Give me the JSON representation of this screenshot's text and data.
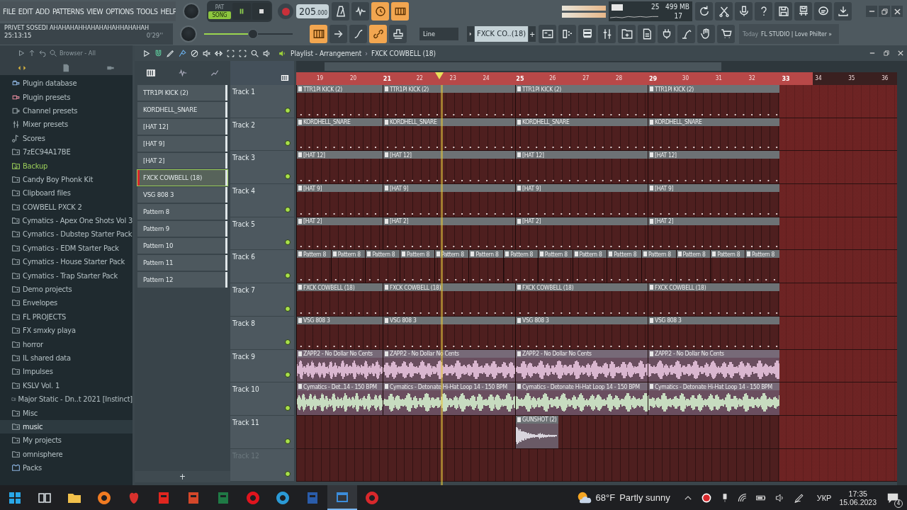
{
  "menu": [
    "FILE",
    "EDIT",
    "ADD",
    "PATTERNS",
    "VIEW",
    "OPTIONS",
    "TOOLS",
    "HELP"
  ],
  "modes": [
    {
      "label": "PAT",
      "selected": false
    },
    {
      "label": "SONG",
      "selected": true
    }
  ],
  "transport": {
    "playing": true,
    "recording": false
  },
  "tempo": {
    "whole": "205",
    "fraction": ".000"
  },
  "toolbar_top": [
    {
      "kind": "metronome",
      "on": false
    },
    {
      "kind": "wave",
      "on": false
    },
    {
      "kind": "clock",
      "on": true
    },
    {
      "kind": "keys",
      "on": true
    }
  ],
  "cpu": {
    "cpu": "25",
    "memory": "499 MB",
    "polyphony": "17"
  },
  "toolbar_right": [
    {
      "kind": "undo"
    },
    {
      "kind": "scissors"
    },
    {
      "kind": "mic"
    },
    {
      "kind": "help"
    },
    {
      "kind": "save"
    },
    {
      "kind": "save-bars"
    },
    {
      "kind": "chat"
    },
    {
      "kind": "download"
    }
  ],
  "hint": {
    "text": "PRIVET SOSEDI AHAHAHAHHAHAHAHAHHAHAHAH",
    "time": "25:13:15",
    "duration": "0'29''"
  },
  "master": {
    "level": 0.55
  },
  "toolbar_bottom": [
    {
      "kind": "piano",
      "on": true
    },
    {
      "kind": "arrow",
      "on": false
    },
    {
      "kind": "curve",
      "on": false
    },
    {
      "kind": "link",
      "on": true
    },
    {
      "kind": "stamp",
      "on": false
    }
  ],
  "snap": {
    "value": "Line"
  },
  "pattern_selector": {
    "value": "FXCK CO..(18)",
    "add": "+"
  },
  "windows_bar": [
    {
      "kind": "playlist"
    },
    {
      "kind": "steps"
    },
    {
      "kind": "channels"
    },
    {
      "kind": "mixer"
    },
    {
      "kind": "browser"
    },
    {
      "kind": "files"
    },
    {
      "kind": "plug"
    },
    {
      "kind": "arm"
    },
    {
      "kind": "hand"
    },
    {
      "kind": "cart"
    }
  ],
  "news": {
    "label": "Today",
    "text": "FL STUDIO | Love Philter »"
  },
  "browser": {
    "title": "Browser - All",
    "items": [
      {
        "label": "Plugin database",
        "kind": "plugin",
        "selected": false
      },
      {
        "label": "Plugin presets",
        "kind": "preset",
        "selected": false
      },
      {
        "label": "Channel presets",
        "kind": "channel",
        "selected": false
      },
      {
        "label": "Mixer presets",
        "kind": "mixer",
        "selected": false
      },
      {
        "label": "Scores",
        "kind": "note",
        "selected": false
      },
      {
        "label": "7zEC94A17BE",
        "kind": "folder",
        "selected": false
      },
      {
        "label": "Backup",
        "kind": "backup",
        "selected": false
      },
      {
        "label": "Candy Boy Phonk Kit",
        "kind": "folder",
        "selected": false
      },
      {
        "label": "Clipboard files",
        "kind": "folder",
        "selected": false
      },
      {
        "label": "COWBELL PXCK 2",
        "kind": "folder",
        "selected": false
      },
      {
        "label": "Cymatics - Apex One Shots Vol 3",
        "kind": "folder",
        "selected": false
      },
      {
        "label": "Cymatics - Dubstep Starter Pack",
        "kind": "folder",
        "selected": false
      },
      {
        "label": "Cymatics - EDM Starter Pack",
        "kind": "folder",
        "selected": false
      },
      {
        "label": "Cymatics - House Starter Pack",
        "kind": "folder",
        "selected": false
      },
      {
        "label": "Cymatics - Trap Starter Pack",
        "kind": "folder",
        "selected": false
      },
      {
        "label": "Demo projects",
        "kind": "folder",
        "selected": false
      },
      {
        "label": "Envelopes",
        "kind": "folder",
        "selected": false
      },
      {
        "label": "FL PROJECTS",
        "kind": "folder",
        "selected": false
      },
      {
        "label": "FX smxky playa",
        "kind": "folder",
        "selected": false
      },
      {
        "label": "horror",
        "kind": "folder",
        "selected": false
      },
      {
        "label": "IL shared data",
        "kind": "folder",
        "selected": false
      },
      {
        "label": "Impulses",
        "kind": "folder",
        "selected": false
      },
      {
        "label": "KSLV Vol. 1",
        "kind": "folder",
        "selected": false
      },
      {
        "label": "Major Static - Dn..t 2021 [Instinct]",
        "kind": "folder",
        "selected": false
      },
      {
        "label": "Misc",
        "kind": "folder",
        "selected": false
      },
      {
        "label": "music",
        "kind": "folder",
        "selected": true
      },
      {
        "label": "My projects",
        "kind": "folder",
        "selected": false
      },
      {
        "label": "omnisphere",
        "kind": "folder",
        "selected": false
      },
      {
        "label": "Packs",
        "kind": "packs",
        "selected": false
      }
    ]
  },
  "playlist": {
    "title": "Playlist - Arrangement",
    "separator": "›",
    "pattern": "FXCK COWBELL (18)"
  },
  "patterns": [
    {
      "label": "TTR1PI KICK (2)",
      "selected": false
    },
    {
      "label": "KORDHELL_SNARE",
      "selected": false
    },
    {
      "label": "[HAT 12]",
      "selected": false
    },
    {
      "label": "[HAT 9]",
      "selected": false
    },
    {
      "label": "[HAT 2]",
      "selected": false
    },
    {
      "label": "FXCK COWBELL  (18)",
      "selected": true
    },
    {
      "label": "VSG 808 3",
      "selected": false
    },
    {
      "label": "Pattern 8",
      "selected": false
    },
    {
      "label": "Pattern 9",
      "selected": false
    },
    {
      "label": "Pattern 10",
      "selected": false
    },
    {
      "label": "Pattern 11",
      "selected": false
    },
    {
      "label": "Pattern 12",
      "selected": false
    }
  ],
  "add_pattern": "+",
  "ruler": [
    {
      "label": "19",
      "major": false
    },
    {
      "label": "20",
      "major": false
    },
    {
      "label": "21",
      "major": true
    },
    {
      "label": "22",
      "major": false
    },
    {
      "label": "23",
      "major": false
    },
    {
      "label": "24",
      "major": false
    },
    {
      "label": "25",
      "major": true
    },
    {
      "label": "26",
      "major": false
    },
    {
      "label": "27",
      "major": false
    },
    {
      "label": "28",
      "major": false
    },
    {
      "label": "29",
      "major": true
    },
    {
      "label": "30",
      "major": false
    },
    {
      "label": "31",
      "major": false
    },
    {
      "label": "32",
      "major": false
    },
    {
      "label": "33",
      "major": true
    },
    {
      "label": "34",
      "major": false
    },
    {
      "label": "35",
      "major": false
    },
    {
      "label": "36",
      "major": false
    }
  ],
  "tracks": [
    {
      "name": "Track 1",
      "greyed": false,
      "clips": [
        {
          "kind": "pattern",
          "label": "TTR1PI KICK (2)"
        },
        {
          "kind": "pattern",
          "label": "TTR1PI KICK (2)"
        },
        {
          "kind": "pattern",
          "label": "TTR1PI KICK (2)"
        },
        {
          "kind": "pattern",
          "label": "TTR1PI KICK (2)"
        }
      ]
    },
    {
      "name": "Track 2",
      "greyed": false,
      "clips": [
        {
          "kind": "pattern",
          "label": "KORDHELL_SNARE"
        },
        {
          "kind": "pattern",
          "label": "KORDHELL_SNARE"
        },
        {
          "kind": "pattern",
          "label": "KORDHELL_SNARE"
        },
        {
          "kind": "pattern",
          "label": "KORDHELL_SNARE"
        }
      ]
    },
    {
      "name": "Track 3",
      "greyed": false,
      "clips": [
        {
          "kind": "pattern",
          "label": "[HAT 12]"
        },
        {
          "kind": "pattern",
          "label": "[HAT 12]"
        },
        {
          "kind": "pattern",
          "label": "[HAT 12]"
        },
        {
          "kind": "pattern",
          "label": "[HAT 12]"
        }
      ]
    },
    {
      "name": "Track 4",
      "greyed": false,
      "clips": [
        {
          "kind": "pattern",
          "label": "[HAT 9]"
        },
        {
          "kind": "pattern",
          "label": "[HAT 9]"
        },
        {
          "kind": "pattern",
          "label": "[HAT 9]"
        },
        {
          "kind": "pattern",
          "label": "[HAT 9]"
        }
      ]
    },
    {
      "name": "Track 5",
      "greyed": false,
      "clips": [
        {
          "kind": "pattern",
          "label": "[HAT 2]"
        },
        {
          "kind": "pattern",
          "label": "[HAT 2]"
        },
        {
          "kind": "pattern",
          "label": "[HAT 2]"
        },
        {
          "kind": "pattern",
          "label": "[HAT 2]"
        }
      ]
    },
    {
      "name": "Track 6",
      "greyed": false,
      "clips": [
        {
          "kind": "pattern",
          "label": "Pattern 8"
        },
        {
          "kind": "pattern",
          "label": "Pattern 8"
        },
        {
          "kind": "pattern",
          "label": "Pattern 8"
        },
        {
          "kind": "pattern",
          "label": "Pattern 8"
        },
        {
          "kind": "pattern",
          "label": "Pattern 8"
        },
        {
          "kind": "pattern",
          "label": "Pattern 8"
        },
        {
          "kind": "pattern",
          "label": "Pattern 8"
        },
        {
          "kind": "pattern",
          "label": "Pattern 8"
        },
        {
          "kind": "pattern",
          "label": "Pattern 8"
        },
        {
          "kind": "pattern",
          "label": "Pattern 8"
        },
        {
          "kind": "pattern",
          "label": "Pattern 8"
        },
        {
          "kind": "pattern",
          "label": "Pattern 8"
        },
        {
          "kind": "pattern",
          "label": "Pattern 8"
        },
        {
          "kind": "pattern",
          "label": "Pattern 8"
        }
      ]
    },
    {
      "name": "Track 7",
      "greyed": false,
      "clips": [
        {
          "kind": "pattern",
          "label": "FXCK COWBELL  (18)"
        },
        {
          "kind": "pattern",
          "label": "FXCK COWBELL  (18)"
        },
        {
          "kind": "pattern",
          "label": "FXCK COWBELL  (18)"
        },
        {
          "kind": "pattern",
          "label": "FXCK COWBELL  (18)"
        }
      ]
    },
    {
      "name": "Track 8",
      "greyed": false,
      "clips": [
        {
          "kind": "pattern",
          "label": "VSG 808 3"
        },
        {
          "kind": "pattern",
          "label": "VSG 808 3"
        },
        {
          "kind": "pattern",
          "label": "VSG 808 3"
        },
        {
          "kind": "pattern",
          "label": "VSG 808 3"
        }
      ]
    },
    {
      "name": "Track 9",
      "greyed": false,
      "color": "#d9b6cf",
      "clips": [
        {
          "kind": "audio",
          "label": "ZAPP.2 - No Dollar No Cents"
        },
        {
          "kind": "audio",
          "label": "ZAPP.2 - No Dollar No Cents"
        },
        {
          "kind": "audio",
          "label": "ZAPP.2 - No Dollar No Cents"
        },
        {
          "kind": "audio",
          "label": "ZAPP.2 - No Dollar No Cents"
        }
      ]
    },
    {
      "name": "Track 10",
      "greyed": false,
      "color": "#c7dcc0",
      "clips": [
        {
          "kind": "audio",
          "label": "Cymatics - Det..14 - 150 BPM"
        },
        {
          "kind": "audio",
          "label": "Cymatics - Detonate Hi-Hat Loop 14 - 150 BPM"
        },
        {
          "kind": "audio",
          "label": "Cymatics - Detonate Hi-Hat Loop 14 - 150 BPM"
        },
        {
          "kind": "audio",
          "label": "Cymatics - Detonate Hi-Hat Loop 14 - 150 BPM"
        }
      ]
    },
    {
      "name": "Track 11",
      "greyed": false,
      "color": "#d8d4dc",
      "clips": [
        {
          "kind": "oneshot",
          "label": "GUNSHOT (2)"
        }
      ]
    },
    {
      "name": "Track 12",
      "greyed": true
    }
  ],
  "taskbar": {
    "apps": [
      {
        "kind": "start",
        "selected": false
      },
      {
        "kind": "task-view",
        "selected": false
      },
      {
        "kind": "folder",
        "selected": false
      },
      {
        "kind": "globe",
        "selected": false
      },
      {
        "kind": "fruit",
        "selected": false
      },
      {
        "kind": "pdf",
        "selected": false
      },
      {
        "kind": "slides",
        "selected": false
      },
      {
        "kind": "sheet",
        "selected": false
      },
      {
        "kind": "ring",
        "selected": false
      },
      {
        "kind": "swirl",
        "selected": false
      },
      {
        "kind": "doc",
        "selected": false
      },
      {
        "kind": "window",
        "selected": true
      },
      {
        "kind": "record",
        "selected": false
      }
    ],
    "weather": {
      "temp": "68°F",
      "text": "Partly sunny"
    },
    "language": "УКР",
    "time": "17:35",
    "date": "15.06.2023",
    "notifications": "4"
  }
}
